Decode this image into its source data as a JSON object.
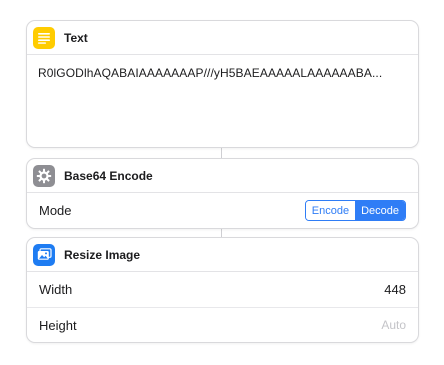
{
  "text_action": {
    "title": "Text",
    "content": "R0lGODlhAQABAIAAAAAAAP///yH5BAEAAAAALAAAAAABA..."
  },
  "base64_action": {
    "title": "Base64 Encode",
    "mode_label": "Mode",
    "options": [
      "Encode",
      "Decode"
    ],
    "selected": "Decode"
  },
  "resize_action": {
    "title": "Resize Image",
    "width_label": "Width",
    "width_value": "448",
    "height_label": "Height",
    "height_placeholder": "Auto"
  },
  "colors": {
    "text_icon_bg": "#ffcc00",
    "gear_icon_bg": "#8e8e93",
    "image_icon_bg": "#1e7cf2",
    "accent": "#2f7df6"
  }
}
